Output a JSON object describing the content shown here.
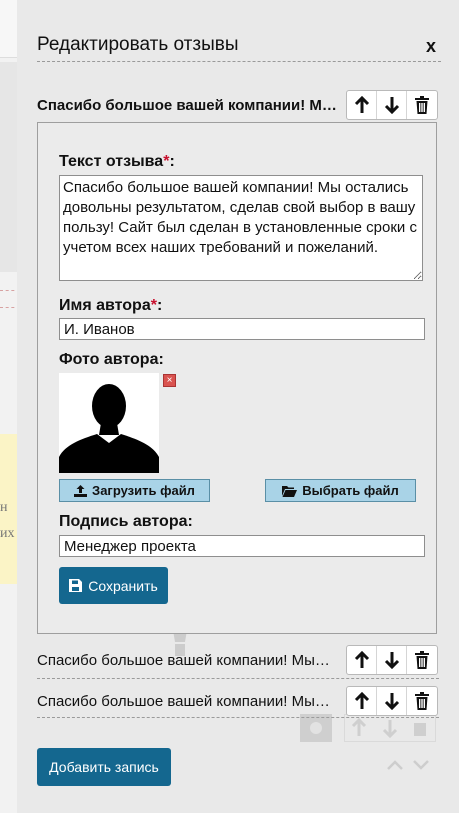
{
  "panel": {
    "title": "Редактировать отзывы",
    "close_label": "x"
  },
  "reviews": [
    {
      "label": "Спасибо большое вашей компании! Мы остались довольны"
    },
    {
      "label": "Спасибо большое вашей компании! Мы остались довольны"
    },
    {
      "label": "Спасибо большое вашей компании! Мы остались довольны"
    }
  ],
  "editor": {
    "text_label": "Текст отзыва",
    "text_value": "Спасибо большое вашей компании! Мы остались довольны результатом, сделав свой выбор в вашу пользу! Сайт был сделан в установленные сроки с учетом всех наших требований и пожеланий.",
    "author_label": "Имя автора",
    "author_value": "И. Иванов",
    "photo_label": "Фото автора:",
    "upload_label": "Загрузить файл",
    "choose_label": "Выбрать файл",
    "signature_label": "Подпись автора:",
    "signature_value": "Менеджер проекта",
    "save_label": "Сохранить",
    "required_mark": "*",
    "colon": ":"
  },
  "add_label": "Добавить запись",
  "background": {
    "yellow_line1": "н",
    "yellow_line2": "их"
  },
  "colors": {
    "primary_button": "#14678f",
    "file_button": "#a9d3e7",
    "required": "#c8102e",
    "panel_bg": "#e9e9e9",
    "delete_photo": "#d9534f"
  },
  "icons": {
    "move_up": "arrow-up-icon",
    "move_down": "arrow-down-icon",
    "delete": "trash-icon",
    "upload": "upload-icon",
    "folder": "folder-open-icon",
    "save": "floppy-disk-icon"
  }
}
